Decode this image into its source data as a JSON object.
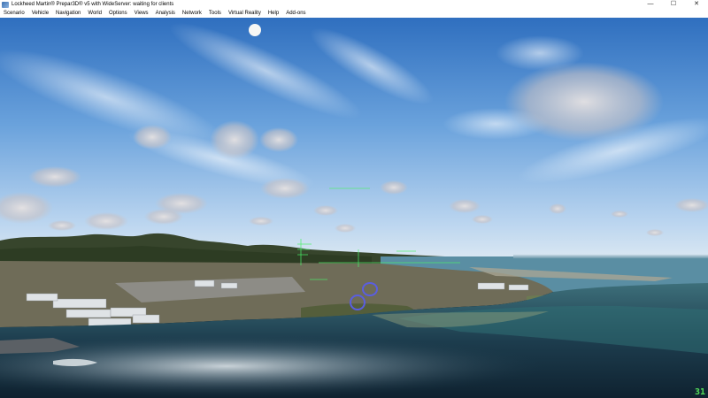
{
  "window": {
    "title": "Lockheed Martin® Prepar3D® v5 with WideServer: waiting for clients",
    "minimize_glyph": "—",
    "maximize_glyph": "☐",
    "close_glyph": "✕"
  },
  "menu": {
    "items": [
      {
        "label": "Scenario"
      },
      {
        "label": "Vehicle"
      },
      {
        "label": "Navigation"
      },
      {
        "label": "World"
      },
      {
        "label": "Options"
      },
      {
        "label": "Views"
      },
      {
        "label": "Analysis"
      },
      {
        "label": "Network"
      },
      {
        "label": "Tools"
      },
      {
        "label": "Virtual Reality"
      },
      {
        "label": "Help"
      },
      {
        "label": "Add-ons"
      }
    ]
  },
  "sim": {
    "frame_rate": "31",
    "hud_color": "#4cf06a",
    "scene_icons": [
      "sun-icon",
      "aircraft-marker-icon"
    ]
  }
}
